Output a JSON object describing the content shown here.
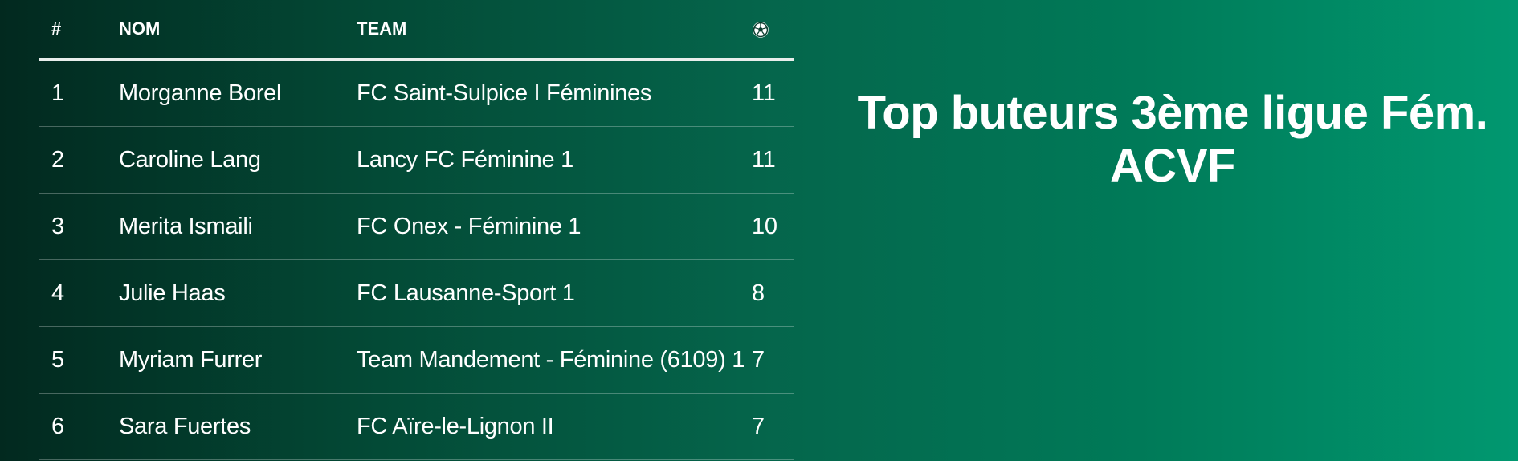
{
  "table": {
    "headers": {
      "rank": "#",
      "name": "NOM",
      "team": "TEAM",
      "goals_icon": "soccer-ball-icon"
    },
    "rows": [
      {
        "rank": "1",
        "name": "Morganne Borel",
        "team": "FC Saint-Sulpice I Féminines",
        "goals": "11"
      },
      {
        "rank": "2",
        "name": "Caroline Lang",
        "team": "Lancy FC Féminine 1",
        "goals": "11"
      },
      {
        "rank": "3",
        "name": "Merita Ismaili",
        "team": "FC Onex - Féminine 1",
        "goals": "10"
      },
      {
        "rank": "4",
        "name": "Julie Haas",
        "team": "FC Lausanne-Sport 1",
        "goals": "8"
      },
      {
        "rank": "5",
        "name": "Myriam Furrer",
        "team": "Team Mandement - Féminine (6109) 1",
        "goals": "7"
      },
      {
        "rank": "6",
        "name": "Sara Fuertes",
        "team": "FC Aïre-le-Lignon II",
        "goals": "7"
      }
    ]
  },
  "title": {
    "line1": "Top buteurs 3ème ligue Fém.",
    "line2": "ACVF"
  },
  "colors": {
    "gradient_start": "#02291f",
    "gradient_end": "#019870",
    "text": "#ffffff"
  }
}
